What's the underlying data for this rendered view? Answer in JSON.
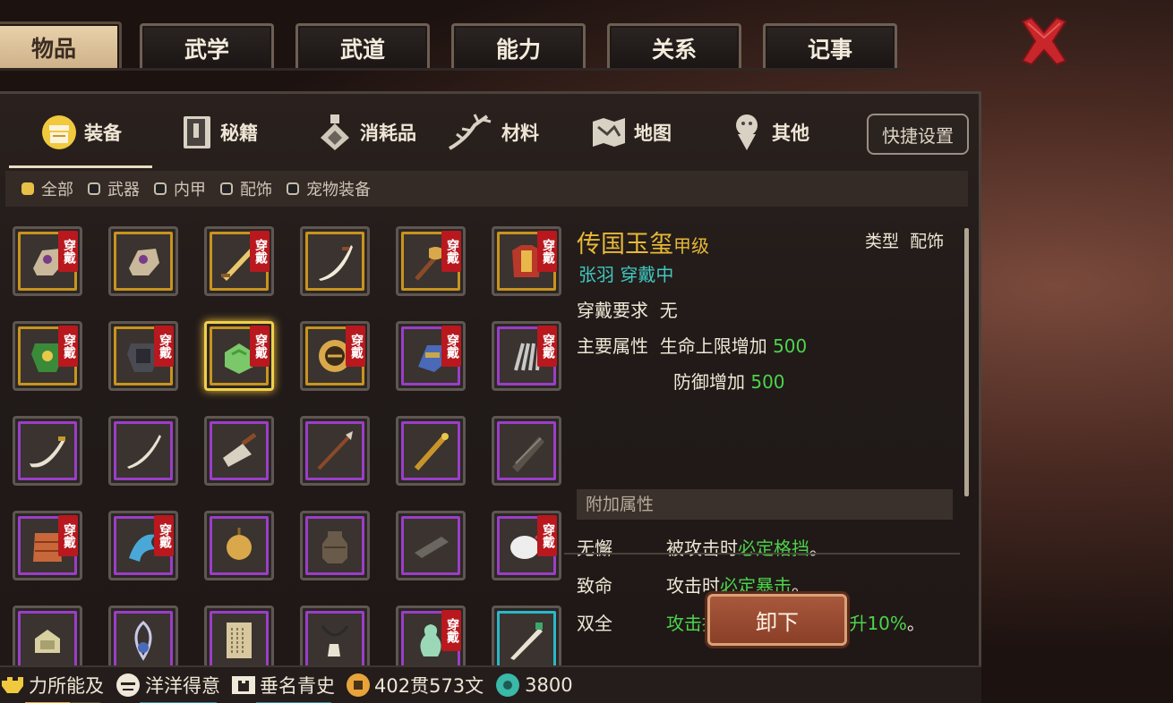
{
  "top_tabs": [
    "物品",
    "武学",
    "武道",
    "能力",
    "关系",
    "记事"
  ],
  "categories": [
    {
      "label": "装备",
      "icon": "armor-icon"
    },
    {
      "label": "秘籍",
      "icon": "book-icon"
    },
    {
      "label": "消耗品",
      "icon": "potion-icon"
    },
    {
      "label": "材料",
      "icon": "herb-icon"
    },
    {
      "label": "地图",
      "icon": "map-icon"
    },
    {
      "label": "其他",
      "icon": "other-icon"
    }
  ],
  "quick_settings": "快捷设置",
  "filters": [
    {
      "label": "全部",
      "checked": true
    },
    {
      "label": "武器",
      "checked": false
    },
    {
      "label": "内甲",
      "checked": false
    },
    {
      "label": "配饰",
      "checked": false
    },
    {
      "label": "宠物装备",
      "checked": false
    }
  ],
  "badge_text": "穿戴",
  "items": [
    {
      "icon": "glove-icon",
      "rarity": "gold",
      "equipped": true
    },
    {
      "icon": "glove-icon",
      "rarity": "gold",
      "equipped": false
    },
    {
      "icon": "sword-icon",
      "rarity": "gold",
      "equipped": true
    },
    {
      "icon": "saber-icon",
      "rarity": "gold",
      "equipped": false
    },
    {
      "icon": "axe-icon",
      "rarity": "gold",
      "equipped": true
    },
    {
      "icon": "robe-icon",
      "rarity": "gold",
      "equipped": true
    },
    {
      "icon": "green-armor-icon",
      "rarity": "gold",
      "equipped": true
    },
    {
      "icon": "dark-armor-icon",
      "rarity": "gold",
      "equipped": true
    },
    {
      "icon": "jade-seal-icon",
      "rarity": "gold",
      "equipped": true,
      "selected": true
    },
    {
      "icon": "mask-icon",
      "rarity": "gold",
      "equipped": true
    },
    {
      "icon": "gauntlet-icon",
      "rarity": "purple",
      "equipped": true
    },
    {
      "icon": "claw-icon",
      "rarity": "purple",
      "equipped": true
    },
    {
      "icon": "curved-sword-icon",
      "rarity": "purple",
      "equipped": false
    },
    {
      "icon": "katana-icon",
      "rarity": "purple",
      "equipped": false
    },
    {
      "icon": "cleaver-icon",
      "rarity": "purple",
      "equipped": false
    },
    {
      "icon": "spear-icon",
      "rarity": "purple",
      "equipped": false
    },
    {
      "icon": "staff-icon",
      "rarity": "purple",
      "equipped": false
    },
    {
      "icon": "scroll-case-icon",
      "rarity": "purple",
      "equipped": false
    },
    {
      "icon": "vest-icon",
      "rarity": "purple",
      "equipped": true
    },
    {
      "icon": "blue-scarf-icon",
      "rarity": "purple",
      "equipped": true
    },
    {
      "icon": "gold-orb-icon",
      "rarity": "purple",
      "equipped": false
    },
    {
      "icon": "jar-icon",
      "rarity": "purple",
      "equipped": false
    },
    {
      "icon": "whetstone-icon",
      "rarity": "purple",
      "equipped": false
    },
    {
      "icon": "pearl-icon",
      "rarity": "purple",
      "equipped": true
    },
    {
      "icon": "seal-stone-icon",
      "rarity": "purple",
      "equipped": false
    },
    {
      "icon": "pendant-icon",
      "rarity": "purple",
      "equipped": false
    },
    {
      "icon": "manual-icon",
      "rarity": "purple",
      "equipped": false
    },
    {
      "icon": "tassel-icon",
      "rarity": "purple",
      "equipped": false
    },
    {
      "icon": "jade-figure-icon",
      "rarity": "purple",
      "equipped": true
    },
    {
      "icon": "green-sword-icon",
      "rarity": "cyan",
      "equipped": false
    }
  ],
  "detail": {
    "name": "传国玉玺",
    "grade": "甲级",
    "type_label": "类型",
    "type_value": "配饰",
    "wearer": "张羽 穿戴中",
    "req_label": "穿戴要求",
    "req_value": "无",
    "main_label": "主要属性",
    "main_attr1": "生命上限增加",
    "main_val1": "500",
    "main_attr2": "防御增加",
    "main_val2": "500",
    "extra_header": "附加属性",
    "extras": [
      {
        "name": "无懈",
        "pre": "被攻击时",
        "hl": "必定格挡",
        "post": "。"
      },
      {
        "name": "致命",
        "pre": "攻击时",
        "hl": "必定暴击",
        "post": "。"
      },
      {
        "name": "双全",
        "pre": "",
        "hl": "攻击提升10%、防御提升10%",
        "post": "。"
      }
    ]
  },
  "unequip": "卸下",
  "status": {
    "s1": "力所能及",
    "s1_fill": 0.6,
    "s2": "洋洋得意",
    "s3": "垂名青史",
    "money": "402贯573文",
    "jade": "3800"
  },
  "colors": {
    "gold": "#c8941e",
    "purple": "#9a3ec8",
    "cyan": "#2ab8c8",
    "badge": "#b8181e",
    "title": "#e7b938",
    "green": "#4cd34c"
  }
}
